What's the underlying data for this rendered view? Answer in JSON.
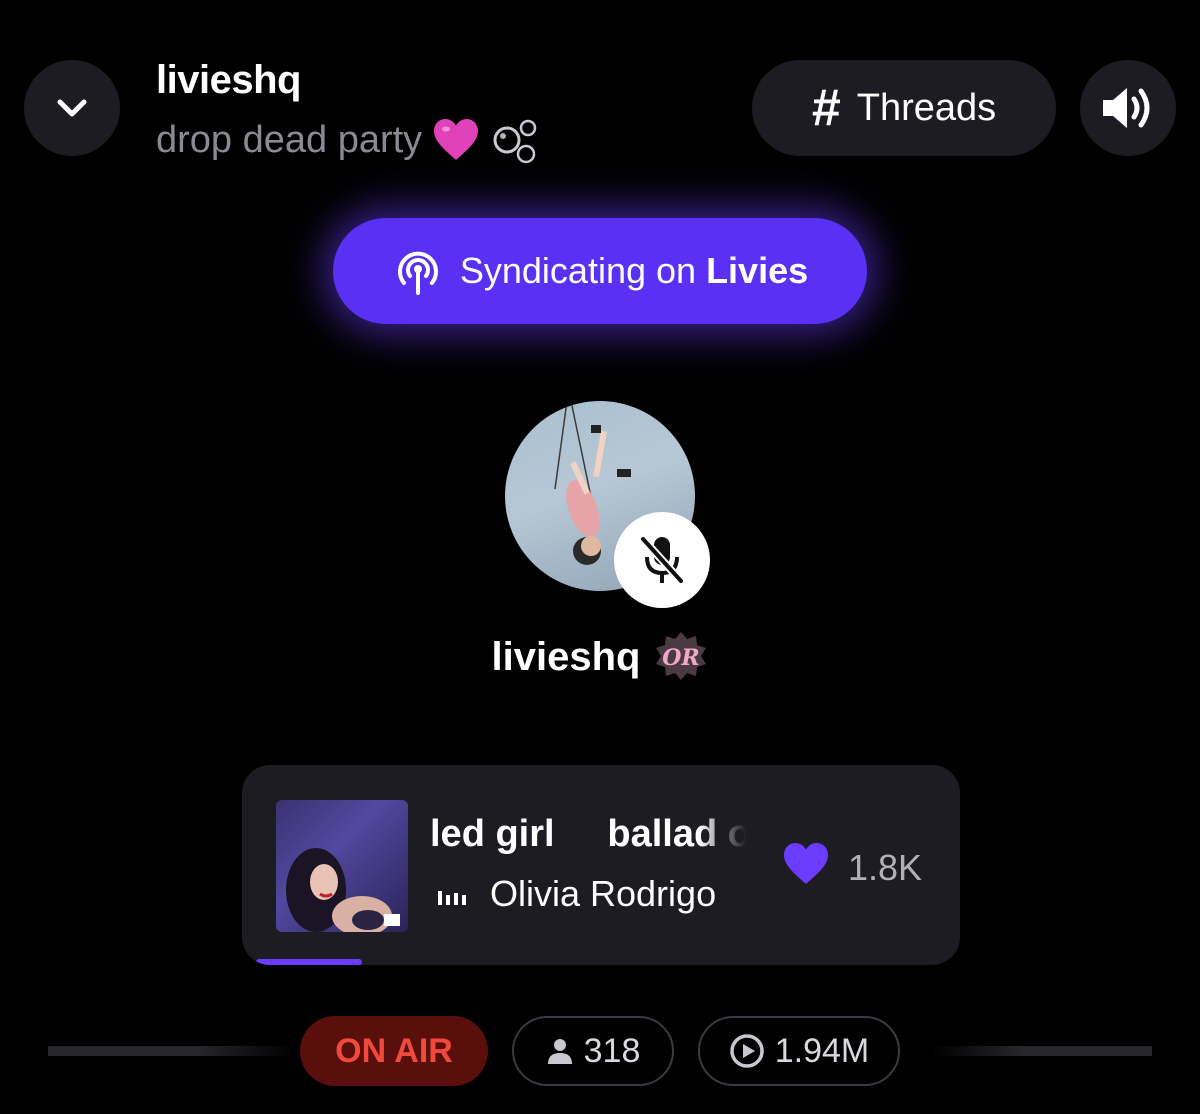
{
  "header": {
    "title": "livieshq",
    "subtitle": "drop dead party",
    "threads_label": "Threads",
    "threads_symbol": "#"
  },
  "syndicate": {
    "prefix": "Syndicating on",
    "platform": "Livies"
  },
  "host": {
    "name": "livieshq",
    "muted": true
  },
  "now_playing": {
    "title": "led girl     ballad o",
    "artist": "Olivia Rodrigo",
    "likes": "1.8K",
    "progress": 0.15
  },
  "status": {
    "on_air_label": "ON AIR",
    "listeners": "318",
    "plays": "1.94M"
  },
  "colors": {
    "accent": "#5a31f4",
    "heart": "#6a3cff",
    "on_air_bg": "#5a0f0c",
    "on_air_text": "#f04a3c"
  }
}
